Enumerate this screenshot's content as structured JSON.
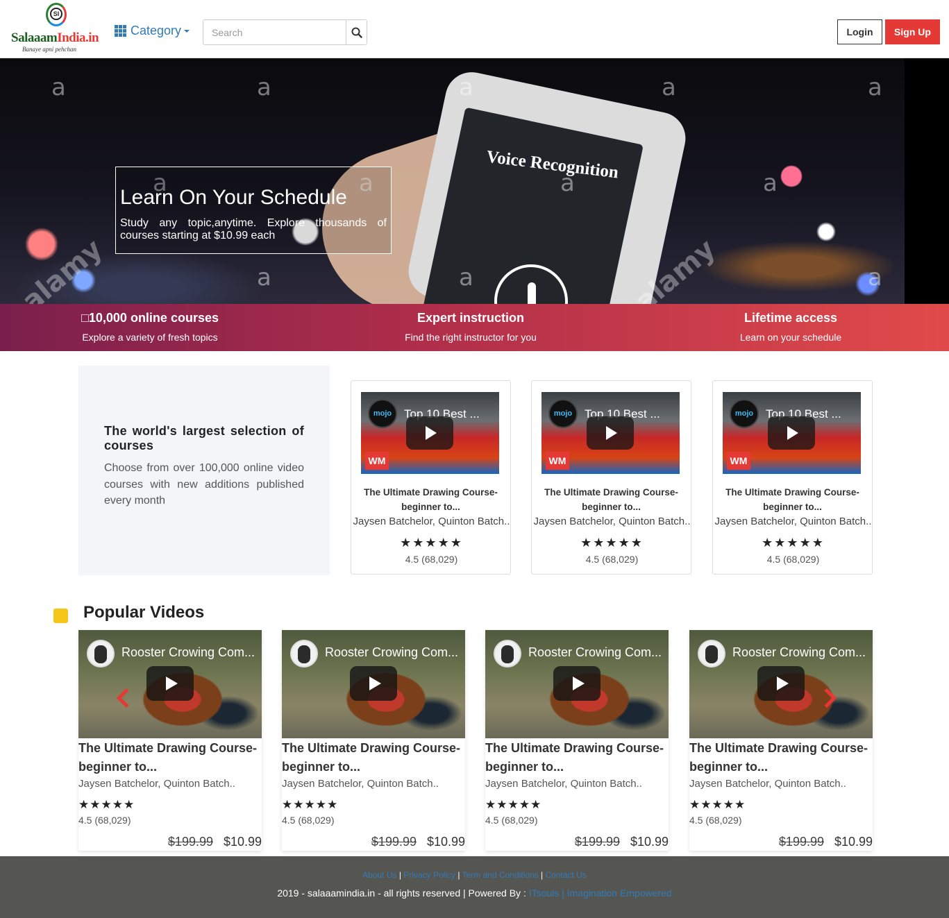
{
  "header": {
    "logo_text_main": "Salaaam",
    "logo_text_accent": "India.in",
    "logo_mark": "SI",
    "logo_tagline": "Banaye apni pehchan",
    "category_label": "Category",
    "search_placeholder": "Search",
    "login_label": "Login",
    "signup_label": "Sign Up"
  },
  "hero": {
    "title": "Learn On Your Schedule",
    "subtitle": "Study any topic,anytime. Explore thousands of courses starting at $10.99 each",
    "phone_text": "Voice Recognition",
    "watermark_letter": "a",
    "watermark_brand": "alamy"
  },
  "features": [
    {
      "title": "□10,000 online courses",
      "subtitle": "Explore a variety of fresh topics"
    },
    {
      "title": "Expert instruction",
      "subtitle": "Find the right instructor for you"
    },
    {
      "title": "Lifetime access",
      "subtitle": "Learn on your schedule"
    }
  ],
  "selection": {
    "title": "The world's largest selection of courses",
    "text": "Choose from over 100,000 online video courses with new additions published every month"
  },
  "course_cards": [
    {
      "thumb_title": "Top 10 Best ...",
      "thumb_logo": "mojo",
      "badge": "WM",
      "title": "The Ultimate Drawing Course- beginner to...",
      "author": "Jaysen Batchelor, Quinton Batch..",
      "stars": "★★★★★",
      "rating": "4.5 (68,029)"
    },
    {
      "thumb_title": "Top 10 Best ...",
      "thumb_logo": "mojo",
      "badge": "WM",
      "title": "The Ultimate Drawing Course- beginner to...",
      "author": "Jaysen Batchelor, Quinton Batch..",
      "stars": "★★★★★",
      "rating": "4.5 (68,029)"
    },
    {
      "thumb_title": "Top 10 Best ...",
      "thumb_logo": "mojo",
      "badge": "WM",
      "title": "The Ultimate Drawing Course- beginner to...",
      "author": "Jaysen Batchelor, Quinton Batch..",
      "stars": "★★★★★",
      "rating": "4.5 (68,029)"
    }
  ],
  "popular": {
    "heading": "Popular Videos",
    "videos": [
      {
        "thumb_title": "Rooster Crowing Com...",
        "title": "The Ultimate Drawing Course- beginner to...",
        "author": "Jaysen Batchelor, Quinton Batch..",
        "stars": "★★★★★",
        "rating": "4.5 (68,029)",
        "old_price": "$199.99",
        "price": "$10.99"
      },
      {
        "thumb_title": "Rooster Crowing Com...",
        "title": "The Ultimate Drawing Course- beginner to...",
        "author": "Jaysen Batchelor, Quinton Batch..",
        "stars": "★★★★★",
        "rating": "4.5 (68,029)",
        "old_price": "$199.99",
        "price": "$10.99"
      },
      {
        "thumb_title": "Rooster Crowing Com...",
        "title": "The Ultimate Drawing Course- beginner to...",
        "author": "Jaysen Batchelor, Quinton Batch..",
        "stars": "★★★★★",
        "rating": "4.5 (68,029)",
        "old_price": "$199.99",
        "price": "$10.99"
      },
      {
        "thumb_title": "Rooster Crowing Com...",
        "title": "The Ultimate Drawing Course- beginner to...",
        "author": "Jaysen Batchelor, Quinton Batch..",
        "stars": "★★★★★",
        "rating": "4.5 (68,029)",
        "old_price": "$199.99",
        "price": "$10.99"
      }
    ]
  },
  "footer": {
    "links": [
      "About Us",
      "Privacy Policy",
      "Term and Conditions",
      "Contact Us"
    ],
    "separator": "|",
    "copyright": "2019 - salaaamindia.in - all rights reserved | Powered By :",
    "powered_link": "ITsouls | Imagination Empowered"
  },
  "colors": {
    "brand_red": "#e53935",
    "link_blue": "#337ab7",
    "band_start": "#7a1f4c",
    "band_end": "#e14a4a",
    "marker_yellow": "#f5c518",
    "footer_bg": "#555652"
  },
  "icons": [
    "grid-icon",
    "caret-down-icon",
    "search-icon",
    "play-icon",
    "star-icon",
    "chevron-left-icon",
    "chevron-right-icon"
  ]
}
